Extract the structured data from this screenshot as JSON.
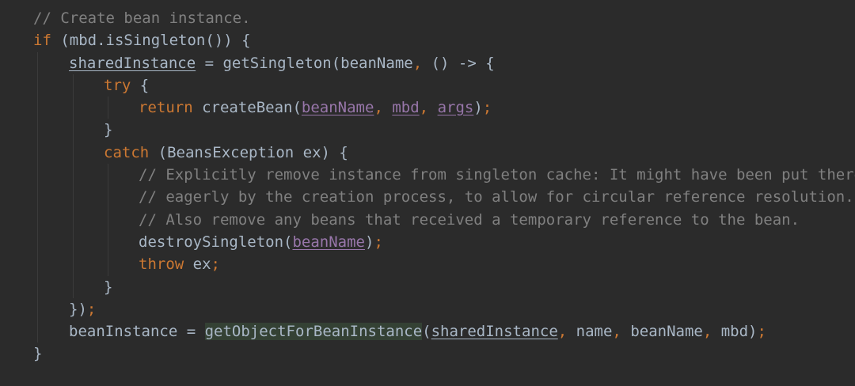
{
  "code": {
    "comment_create": "// Create bean instance.",
    "kw_if": "if",
    "cond": " (mbd.isSingleton()) {",
    "var_shared": "sharedInstance",
    "assign_singleton": " = getSingleton(beanName",
    "comma": ",",
    "lambda": " () -> {",
    "kw_try": "try",
    "open_brace": " {",
    "kw_return": "return",
    "create_call": " createBean(",
    "param_beanName": "beanName",
    "param_mbd": "mbd",
    "param_args": "args",
    "close_paren": ")",
    "semicolon": ";",
    "close_brace": "}",
    "kw_catch": "catch",
    "catch_clause": " (BeansException ex) {",
    "comment_1": "// Explicitly remove instance from singleton cache: It might have been put there",
    "comment_2": "// eagerly by the creation process, to allow for circular reference resolution.",
    "comment_3": "// Also remove any beans that received a temporary reference to the bean.",
    "destroy_call": "destroySingleton(",
    "kw_throw": "throw",
    "throw_var": " ex",
    "lambda_close": "})",
    "var_beanInstance": "beanInstance",
    "assign_eq": " = ",
    "method_getObject": "getObjectForBeanInstance",
    "open_paren": "(",
    "arg_name": " name",
    "arg_beanName": " beanName",
    "arg_mbd": " mbd"
  }
}
